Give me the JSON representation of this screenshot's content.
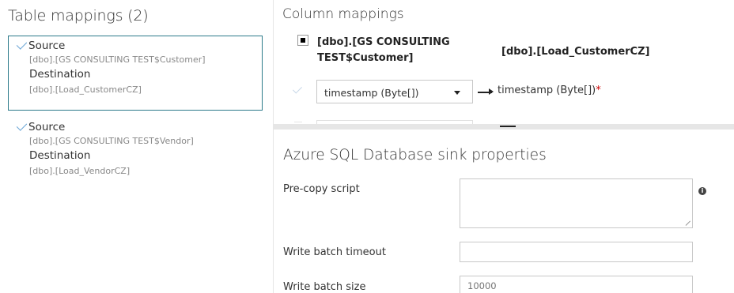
{
  "table_mappings": {
    "title": "Table mappings (2)",
    "items": [
      {
        "source_label": "Source",
        "source_value": "[dbo].[GS CONSULTING TEST$Customer]",
        "destination_label": "Destination",
        "destination_value": "[dbo].[Load_CustomerCZ]",
        "selected": true
      },
      {
        "source_label": "Source",
        "source_value": "[dbo].[GS CONSULTING TEST$Vendor]",
        "destination_label": "Destination",
        "destination_value": "[dbo].[Load_VendorCZ]",
        "selected": false
      }
    ]
  },
  "column_mappings": {
    "title": "Column mappings",
    "source_header": "[dbo].[GS CONSULTING TEST$Customer]",
    "destination_header": "[dbo].[Load_CustomerCZ]",
    "rows": [
      {
        "source_column": "timestamp (Byte[])",
        "destination_column": "timestamp (Byte[])",
        "required_marker": "*"
      }
    ]
  },
  "sink_properties": {
    "title": "Azure SQL Database sink properties",
    "pre_copy_script_label": "Pre-copy script",
    "pre_copy_script_value": "",
    "write_batch_timeout_label": "Write batch timeout",
    "write_batch_timeout_value": "",
    "write_batch_size_label": "Write batch size",
    "write_batch_size_placeholder": "10000"
  },
  "icons": {
    "info": "info-icon",
    "checkbox": "checkmark-icon",
    "dropdown": "chevron-down-icon",
    "arrow": "arrow-right-icon"
  },
  "colors": {
    "selection_border": "#2c7a8a",
    "check": "#6aa5d6",
    "required": "#cc0000",
    "splitter": "#e6e6e6"
  }
}
